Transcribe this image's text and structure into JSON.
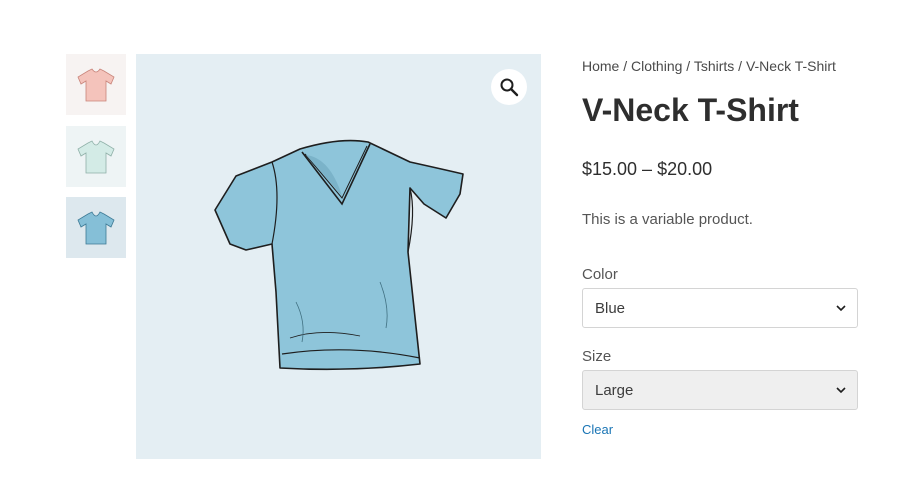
{
  "gallery": {
    "thumbnails": [
      {
        "name": "pink v-neck",
        "color": "#f4c3bb"
      },
      {
        "name": "mint v-neck",
        "color": "#d3ebe6"
      },
      {
        "name": "blue v-neck",
        "color": "#85bfd7"
      }
    ],
    "main_shirt_color": "#8ec5da",
    "zoom_icon": "magnifier-icon"
  },
  "breadcrumb": {
    "items": [
      "Home",
      "Clothing",
      "Tshirts",
      "V-Neck T-Shirt"
    ],
    "separator": "/"
  },
  "product": {
    "title": "V-Neck T-Shirt",
    "price": "$15.00 – $20.00",
    "description": "This is a variable product."
  },
  "variations": {
    "color_label": "Color",
    "color_value": "Blue",
    "size_label": "Size",
    "size_value": "Large",
    "clear_label": "Clear"
  },
  "colors": {
    "link": "#1a75b5",
    "image_background": "#e4eef3"
  }
}
